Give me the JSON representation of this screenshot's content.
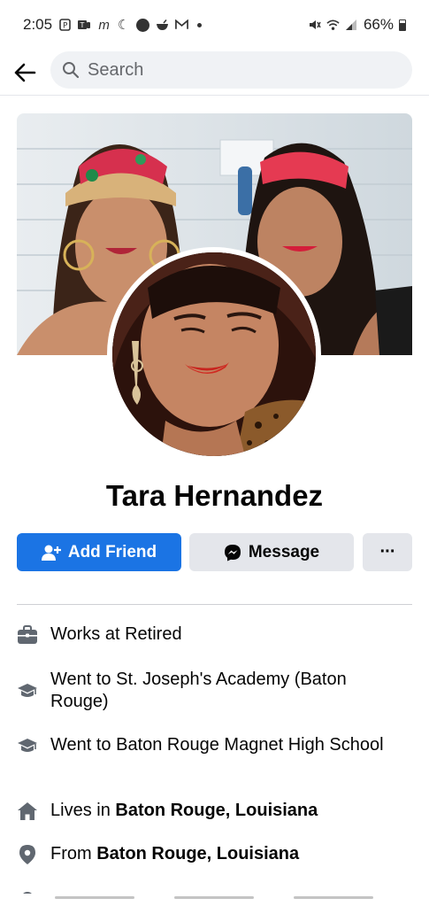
{
  "status_bar": {
    "time": "2:05",
    "icons_left": [
      "notification-p-icon",
      "teams-icon",
      "mcdonalds-icon",
      "moon-icon",
      "circle-icon",
      "bowl-icon",
      "gmail-icon",
      "dot-icon"
    ],
    "mcd_glyph": "m",
    "moon_glyph": "☾",
    "icons_right": [
      "mute-icon",
      "wifi-icon",
      "signal-icon",
      "battery-icon"
    ],
    "mute_glyph": "🔇",
    "battery": "66%"
  },
  "top_bar": {
    "back_icon": "arrow-left-icon",
    "search_placeholder": "Search"
  },
  "profile": {
    "name": "Tara Hernandez"
  },
  "actions": {
    "add_friend": "Add Friend",
    "message": "Message",
    "more": "···"
  },
  "details": [
    {
      "icon": "briefcase-icon",
      "prefix": "Works at Retired",
      "bold": ""
    },
    {
      "icon": "graduation-cap-icon",
      "prefix": "Went to St. Joseph's Academy (Baton Rouge)",
      "bold": ""
    },
    {
      "icon": "graduation-cap-icon",
      "prefix": "Went to Baton Rouge Magnet High School",
      "bold": ""
    },
    {
      "icon": "home-icon",
      "prefix": "Lives in ",
      "bold": "Baton Rouge, Louisiana"
    },
    {
      "icon": "location-pin-icon",
      "prefix": "From ",
      "bold": "Baton Rouge, Louisiana"
    }
  ],
  "colors": {
    "primary": "#1b74e4",
    "secondary_button": "#e4e6eb",
    "search_bg": "#f0f2f5",
    "text": "#050505",
    "muted_text": "#65676b",
    "icon_gray": "#606770"
  }
}
